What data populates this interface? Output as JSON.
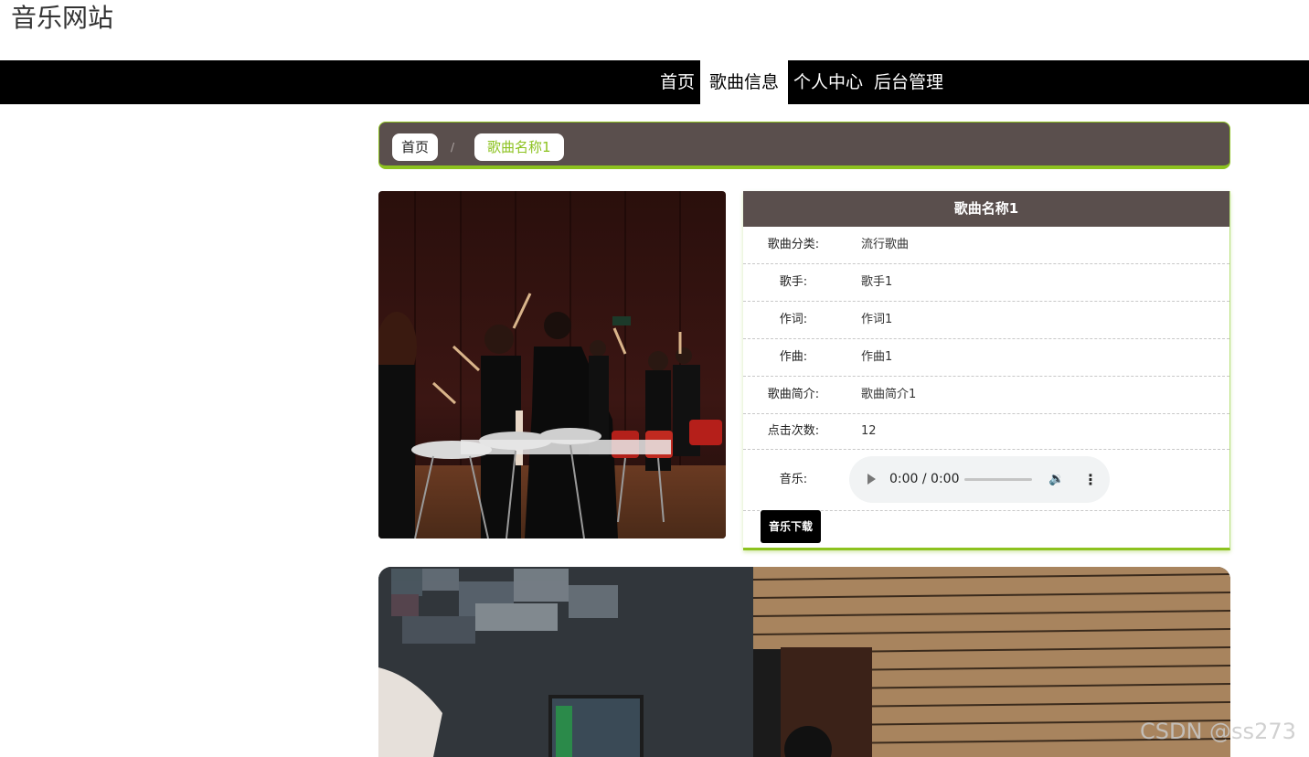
{
  "site": {
    "title": "音乐网站"
  },
  "nav": {
    "items": [
      "首页",
      "歌曲信息",
      "个人中心",
      "后台管理"
    ],
    "active_index": 1
  },
  "breadcrumb": {
    "home": "首页",
    "separator": "/",
    "current": "歌曲名称1"
  },
  "song": {
    "title": "歌曲名称1",
    "fields": [
      {
        "label": "歌曲分类:",
        "value": "流行歌曲"
      },
      {
        "label": "歌手:",
        "value": "歌手1"
      },
      {
        "label": "作词:",
        "value": "作词1"
      },
      {
        "label": "作曲:",
        "value": "作曲1"
      },
      {
        "label": "歌曲简介:",
        "value": "歌曲简介1"
      },
      {
        "label": "点击次数:",
        "value": "12"
      }
    ],
    "music_label": "音乐:",
    "player_time": "0:00 / 0:00",
    "download_label": "音乐下载"
  },
  "watermark": "CSDN @ss273",
  "icons": {
    "play": "play-icon",
    "volume": "volume-icon",
    "more": "more-options-icon"
  },
  "colors": {
    "accent": "#8cc21f",
    "panel_header": "#5a4f4d",
    "navbar": "#000000"
  }
}
